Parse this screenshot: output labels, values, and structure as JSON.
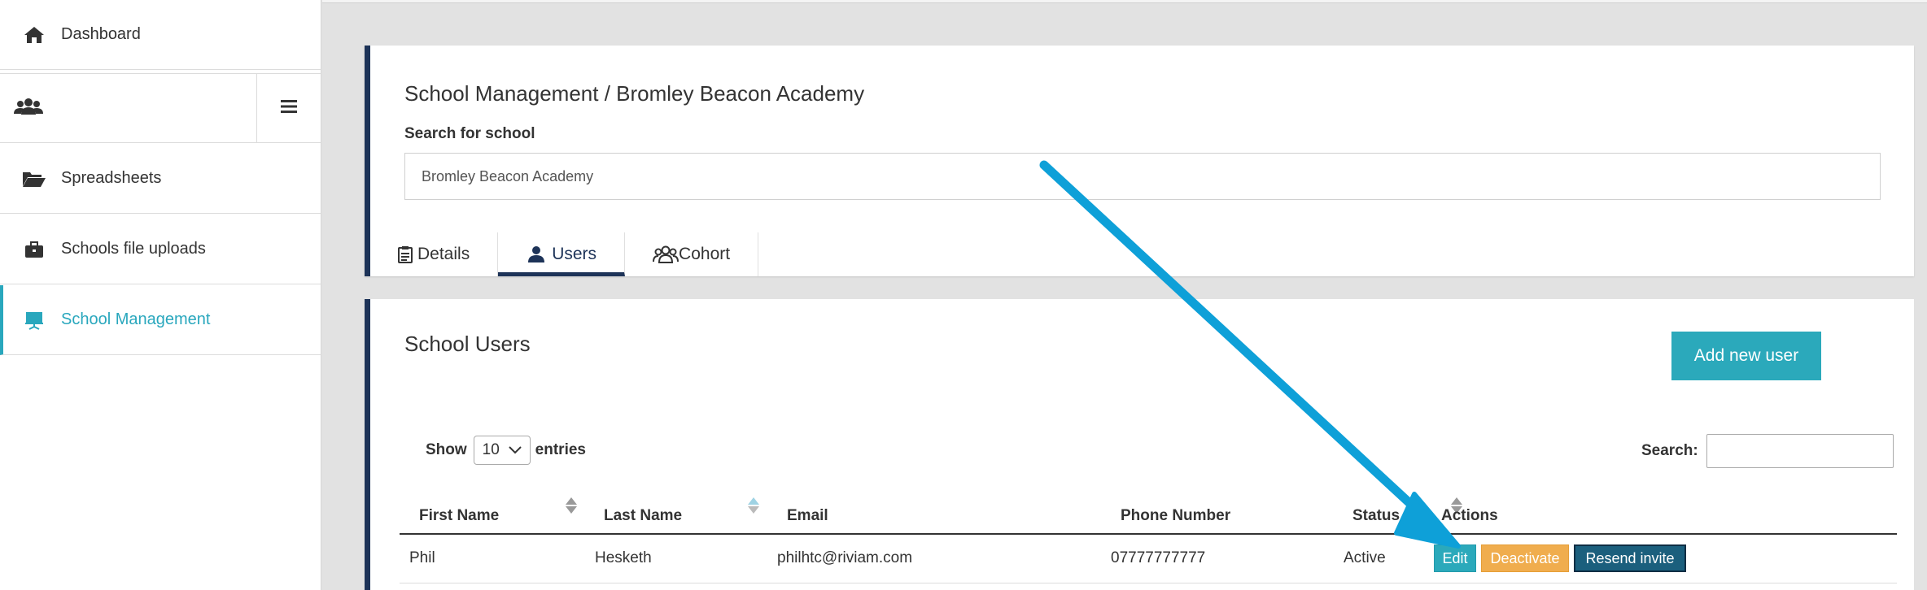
{
  "sidebar": {
    "items": [
      {
        "label": "Dashboard",
        "icon": "home-icon"
      },
      {
        "label": "",
        "icon": "users-group-icon"
      },
      {
        "label": "Spreadsheets",
        "icon": "folder-open-icon"
      },
      {
        "label": "Schools file uploads",
        "icon": "briefcase-icon"
      },
      {
        "label": "School Management",
        "icon": "easel-icon"
      }
    ],
    "menu_icon": "hamburger-icon",
    "accent_color": "#29a7bd"
  },
  "header_panel": {
    "title": "School Management / Bromley Beacon Academy",
    "search_label": "Search for school",
    "search_value": "Bromley Beacon Academy",
    "tabs": [
      {
        "label": "Details",
        "icon": "clipboard-icon",
        "active": false
      },
      {
        "label": "Users",
        "icon": "user-icon",
        "active": true
      },
      {
        "label": "Cohort",
        "icon": "users-group-icon",
        "active": false
      }
    ],
    "accent_color": "#1d3358"
  },
  "users_panel": {
    "title": "School Users",
    "add_button": "Add new user",
    "show_label": "Show",
    "entries_value": "10",
    "entries_label": "entries",
    "search_label": "Search:",
    "columns": [
      "First Name",
      "Last Name",
      "Email",
      "Phone Number",
      "Status",
      "Actions"
    ],
    "rows": [
      {
        "first_name": "Phil",
        "last_name": "Hesketh",
        "email": "philhtc@riviam.com",
        "phone": "07777777777",
        "status": "Active",
        "actions": {
          "edit": "Edit",
          "deactivate": "Deactivate",
          "resend": "Resend invite"
        }
      }
    ]
  },
  "annotation": {
    "arrow_color": "#0ea0d8"
  }
}
